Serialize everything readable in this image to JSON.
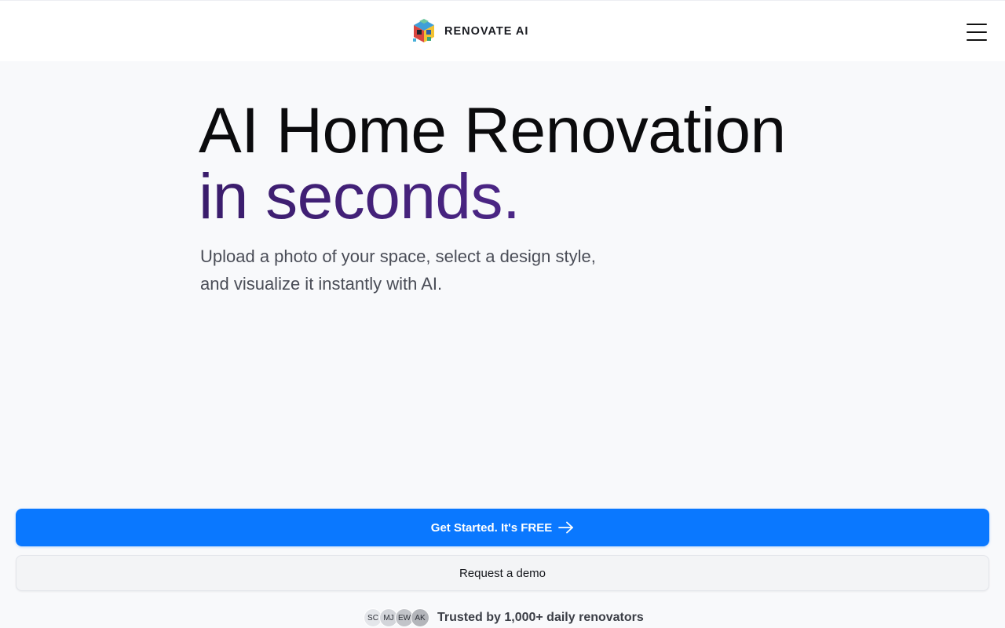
{
  "header": {
    "logo_text": "RENOVATE AI",
    "menu_icon": "hamburger-menu-icon"
  },
  "hero": {
    "title_line1": "AI Home Renovation",
    "title_line2": "in seconds.",
    "subtitle": "Upload a photo of your space, select a design style, and visualize it instantly with AI."
  },
  "actions": {
    "primary_label": "Get Started. It's FREE",
    "primary_icon": "arrow-right-icon",
    "secondary_label": "Request a demo"
  },
  "trust": {
    "avatars": [
      {
        "initials": "SC",
        "color": "#e4e6ea"
      },
      {
        "initials": "MJ",
        "color": "#d3d5da"
      },
      {
        "initials": "EW",
        "color": "#c2c4c9"
      },
      {
        "initials": "AK",
        "color": "#b3b5ba"
      }
    ],
    "text": "Trusted by 1,000+ daily renovators"
  },
  "colors": {
    "primary": "#0a78ff",
    "accent_gradient_start": "#3a1c6b",
    "accent_gradient_end": "#5a2e9c",
    "background": "#f8f9fb"
  }
}
